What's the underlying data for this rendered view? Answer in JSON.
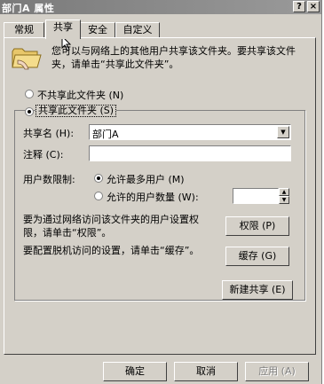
{
  "window": {
    "title": "部门A 属性",
    "help_glyph": "?",
    "close_glyph": "×"
  },
  "tabs": [
    {
      "label": "常规",
      "active": false
    },
    {
      "label": "共享",
      "active": true
    },
    {
      "label": "安全",
      "active": false
    },
    {
      "label": "自定义",
      "active": false
    }
  ],
  "icon": {
    "name": "shared-folder-icon"
  },
  "description": "您可以与网络上的其他用户共享该文件夹。要共享该文件夹，请单击“共享此文件夹”。",
  "sharing": {
    "no_share_label": "不共享此文件夹 (N)",
    "share_label": "共享此文件夹 (S)",
    "selected": "share"
  },
  "share_name": {
    "label": "共享名 (H):",
    "value": "部门A"
  },
  "comment": {
    "label": "注释 (C):",
    "value": ""
  },
  "user_limit": {
    "label": "用户数限制:",
    "max_label": "允许最多用户 (M)",
    "count_label": "允许的用户数量 (W):",
    "selected": "max",
    "count_value": ""
  },
  "permissions": {
    "text": "要为通过网络访问该文件夹的用户设置权限，请单击“权限”。",
    "button": "权限 (P)"
  },
  "caching": {
    "text": "要配置脱机访问的设置，请单击“缓存”。",
    "button": "缓存 (G)"
  },
  "new_share_button": "新建共享 (E)",
  "footer": {
    "ok": "确定",
    "cancel": "取消",
    "apply": "应用 (A)"
  },
  "colors": {
    "face": "#d4d0c8",
    "titlebar": "#8a8a8a",
    "disabled_text": "#808080"
  }
}
